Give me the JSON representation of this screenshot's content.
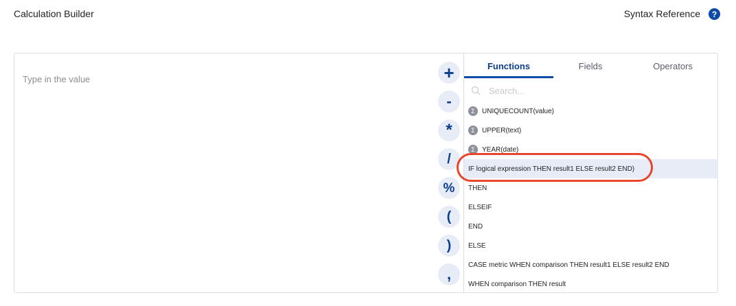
{
  "header": {
    "title": "Calculation Builder",
    "syntax_reference": "Syntax Reference",
    "help_glyph": "?"
  },
  "editor": {
    "placeholder": "Type in the value"
  },
  "operators": [
    "+",
    "-",
    "*",
    "/",
    "%",
    "(",
    ")",
    ","
  ],
  "tabs": [
    {
      "label": "Functions",
      "active": true
    },
    {
      "label": "Fields",
      "active": false
    },
    {
      "label": "Operators",
      "active": false
    }
  ],
  "search": {
    "placeholder": "Search..."
  },
  "functions": [
    {
      "label": "UNIQUECOUNT(value)",
      "icon": "sigma-icon",
      "glyph": "Σ"
    },
    {
      "label": "UPPER(text)",
      "icon": "sigma-icon",
      "glyph": "Σ"
    },
    {
      "label": "YEAR(date)",
      "icon": "sigma-icon",
      "glyph": "Σ"
    },
    {
      "label": "IF logical expression THEN result1 ELSE result2 END)",
      "highlighted": true
    },
    {
      "label": "THEN"
    },
    {
      "label": "ELSEIF"
    },
    {
      "label": "END"
    },
    {
      "label": "ELSE"
    },
    {
      "label": "CASE metric WHEN comparison THEN result1 ELSE result2 END"
    },
    {
      "label": "WHEN comparison THEN result"
    }
  ],
  "colors": {
    "accent": "#0b4aa6",
    "highlight_row": "#e8ecf6",
    "annotation": "#e8452c"
  }
}
